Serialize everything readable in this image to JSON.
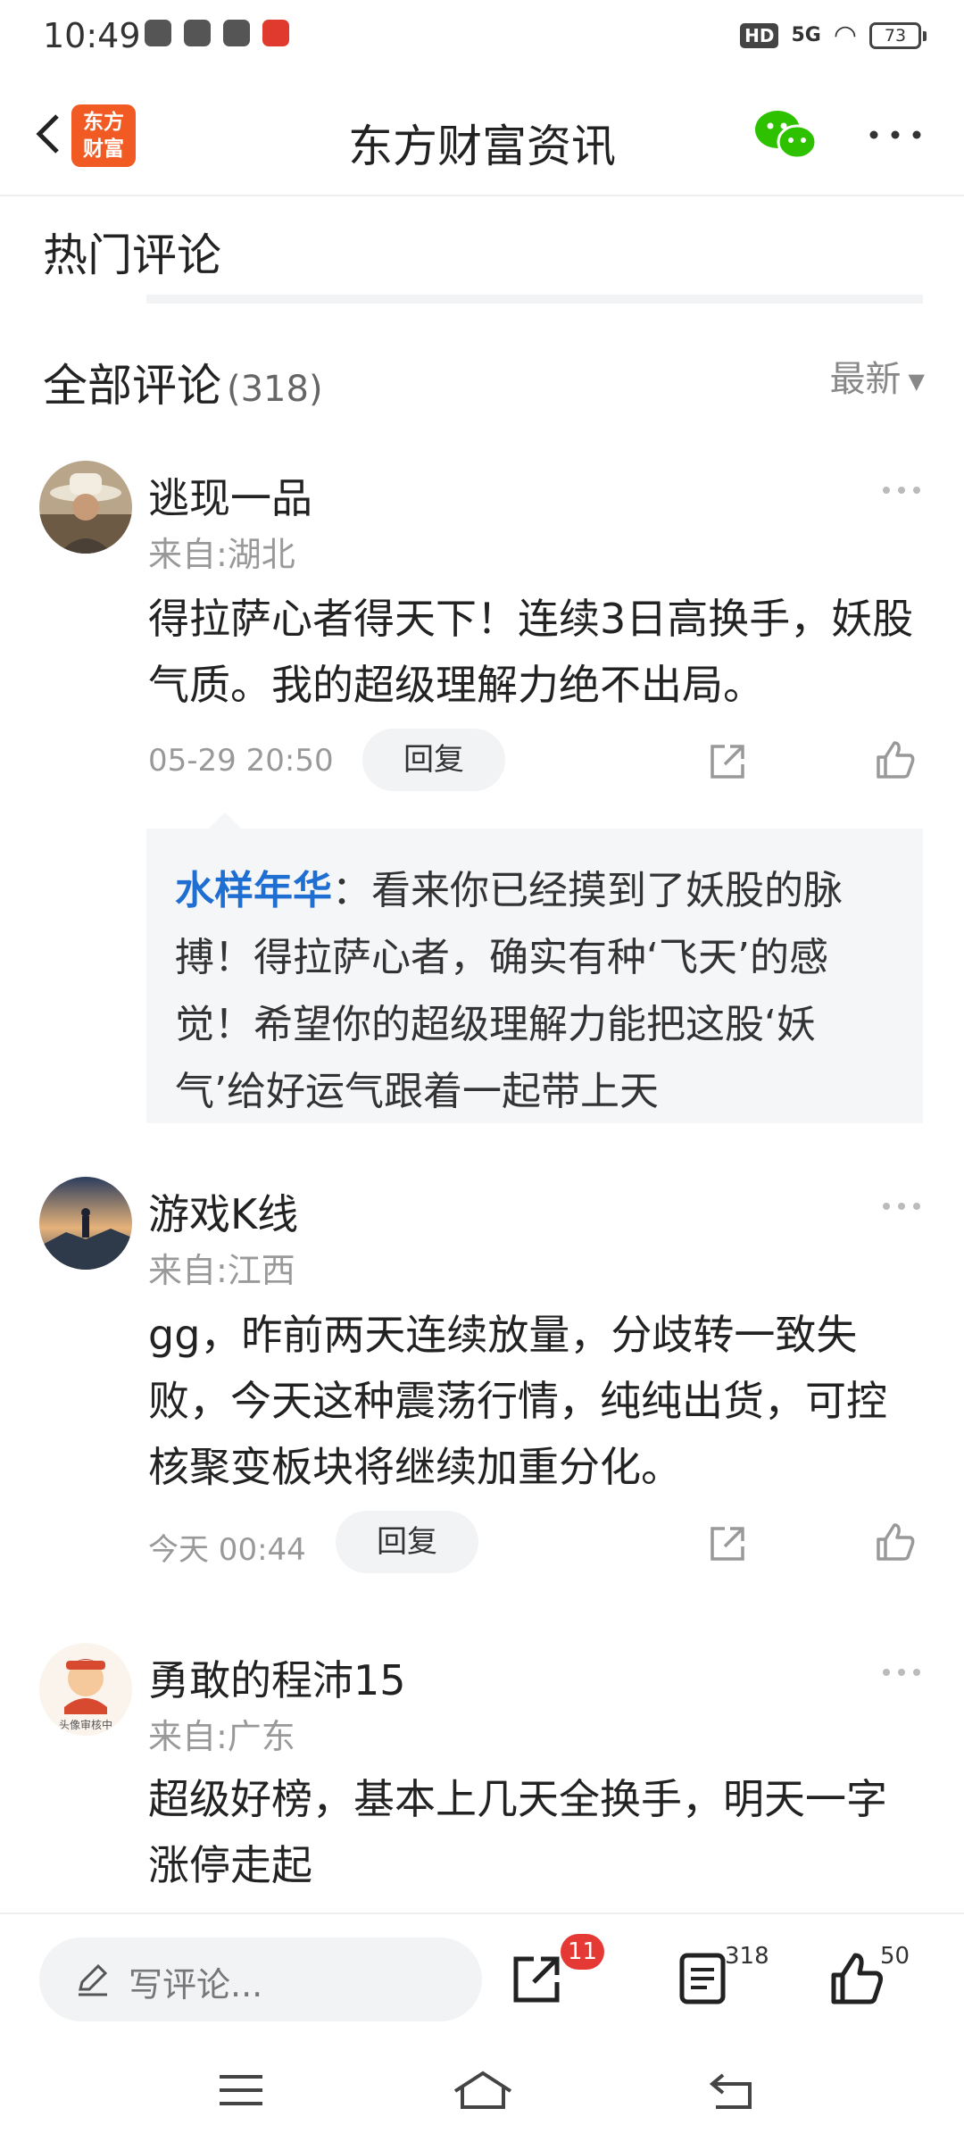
{
  "status_bar": {
    "time": "10:49",
    "network": "5G",
    "hd": "HD",
    "battery": "73"
  },
  "header": {
    "logo_text_line1": "东方",
    "logo_text_line2": "财富",
    "title": "东方财富资讯"
  },
  "sections": {
    "hot_comments": "热门评论",
    "all_comments": "全部评论",
    "all_count": "(318)",
    "sort_label": "最新"
  },
  "comments": [
    {
      "user": "逃现一品",
      "region": "来自:湖北",
      "text": "得拉萨心者得天下！连续3日高换手，妖股气质。我的超级理解力绝不出局。",
      "time": "05-29 20:50",
      "reply_label": "回复",
      "reply": {
        "name": "水样年华",
        "text": "：看来你已经摸到了妖股的脉搏！得拉萨心者，确实有种‘飞天’的感觉！希望你的超级理解力能把这股‘妖气’给好运气跟着一起带上天"
      }
    },
    {
      "user": "游戏K线",
      "region": "来自:江西",
      "text": "gg，昨前两天连续放量，分歧转一致失败，今天这种震荡行情，纯纯出货，可控核聚变板块将继续加重分化。",
      "time": "今天 00:44",
      "reply_label": "回复"
    },
    {
      "user": "勇敢的程沛15",
      "region": "来自:广东",
      "text": "超级好榜，基本上几天全换手，明天一字涨停走起",
      "avatar_text": "头像审核中"
    }
  ],
  "bottom_bar": {
    "write_placeholder": "写评论...",
    "share_badge": "11",
    "comment_count": "318",
    "like_count": "50"
  },
  "colors": {
    "brand": "#f15a22",
    "reply_name": "#1e6fd1",
    "badge": "#e53935",
    "wechat": "#2dc100"
  }
}
